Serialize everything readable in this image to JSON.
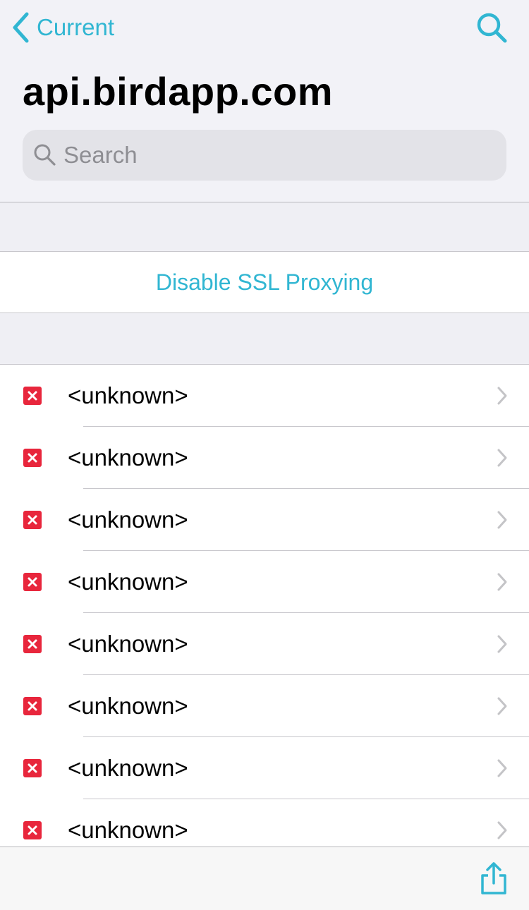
{
  "nav": {
    "back_label": "Current",
    "title": "api.birdapp.com"
  },
  "search": {
    "placeholder": "Search",
    "value": ""
  },
  "actions": {
    "disable_ssl_label": "Disable SSL Proxying"
  },
  "list": {
    "items": [
      {
        "label": "<unknown>",
        "status_icon": "failed-x-icon"
      },
      {
        "label": "<unknown>",
        "status_icon": "failed-x-icon"
      },
      {
        "label": "<unknown>",
        "status_icon": "failed-x-icon"
      },
      {
        "label": "<unknown>",
        "status_icon": "failed-x-icon"
      },
      {
        "label": "<unknown>",
        "status_icon": "failed-x-icon"
      },
      {
        "label": "<unknown>",
        "status_icon": "failed-x-icon"
      },
      {
        "label": "<unknown>",
        "status_icon": "failed-x-icon"
      },
      {
        "label": "<unknown>",
        "status_icon": "failed-x-icon"
      }
    ]
  },
  "toolbar": {
    "share_icon": "share-icon"
  },
  "colors": {
    "accent": "#31b6d2",
    "error": "#e8263c",
    "header_bg": "#f2f2f7",
    "separator": "#c8c7cc"
  }
}
